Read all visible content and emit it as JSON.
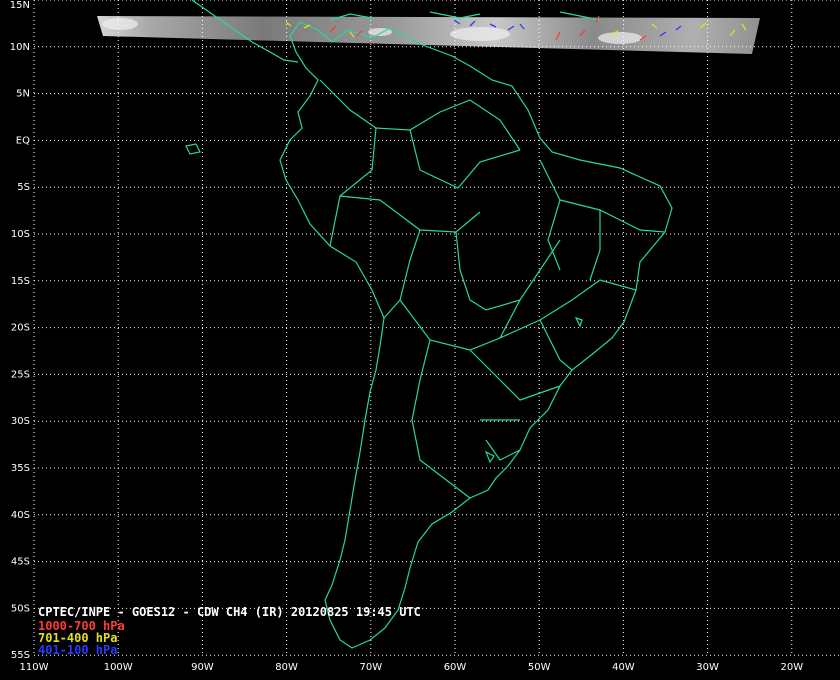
{
  "title": "CPTEC/INPE - GOES12 - CDW CH4 (IR) 20120825 19:45 UTC",
  "legend": [
    {
      "label": "1000-700 hPa",
      "color": "#ff3a3a"
    },
    {
      "label": "701-400 hPa",
      "color": "#e0e020"
    },
    {
      "label": "401-100 hPa",
      "color": "#2a3aff"
    }
  ],
  "colors": {
    "background": "#000000",
    "coastline": "#2ad6a0",
    "grid": "#ffffff",
    "label": "#ffffff"
  },
  "latitude_labels": [
    "15N",
    "10N",
    "5N",
    "EQ",
    "5S",
    "10S",
    "15S",
    "20S",
    "25S",
    "30S",
    "35S",
    "40S",
    "45S",
    "50S",
    "55S"
  ],
  "longitude_labels": [
    "110W",
    "100W",
    "90W",
    "80W",
    "70W",
    "60W",
    "50W",
    "40W",
    "30W",
    "20W"
  ]
}
